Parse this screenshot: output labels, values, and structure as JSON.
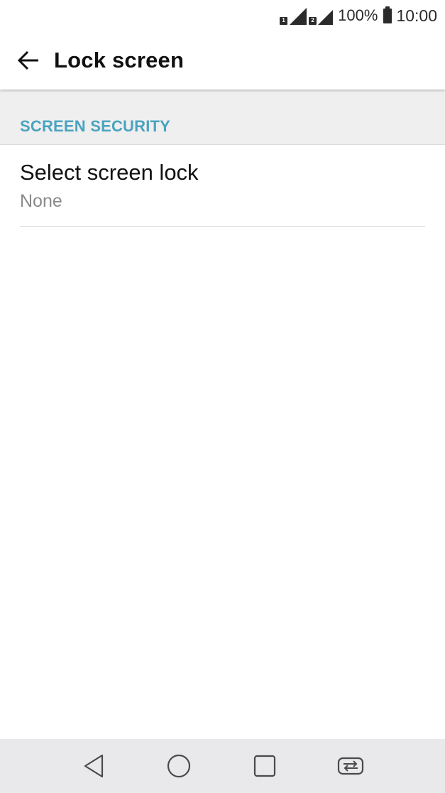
{
  "status_bar": {
    "sim1_label": "1",
    "sim2_label": "2",
    "battery_percent": "100%",
    "time": "10:00",
    "icons": [
      "sim1-signal-icon",
      "sim2-signal-icon",
      "battery-icon"
    ]
  },
  "app_bar": {
    "title": "Lock screen",
    "back_icon": "back-arrow-icon"
  },
  "section": {
    "header": "SCREEN SECURITY",
    "header_color": "#4aa3bf"
  },
  "list": {
    "items": [
      {
        "title": "Select screen lock",
        "summary": "None"
      }
    ]
  },
  "nav_bar": {
    "icons": [
      "back-triangle-icon",
      "home-circle-icon",
      "recents-square-icon",
      "dual-window-icon"
    ]
  }
}
